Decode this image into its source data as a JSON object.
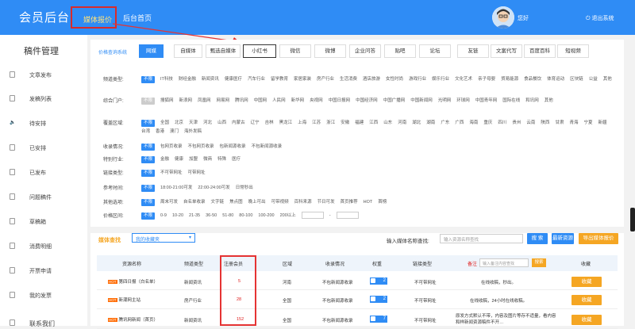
{
  "header": {
    "brand": "会员后台",
    "nav_active": "媒体报价",
    "nav_home": "后台首页",
    "greeting": "您好",
    "logout": "退出系统"
  },
  "sidebar": {
    "title": "稿件管理",
    "items": [
      {
        "label": "文章发布",
        "icon": "document-icon"
      },
      {
        "label": "发稿列表",
        "icon": "list-icon"
      },
      {
        "label": "待安排",
        "icon": "speaker-icon"
      },
      {
        "label": "已安排",
        "icon": "doc-check-icon"
      },
      {
        "label": "已发布",
        "icon": "doc-send-icon"
      },
      {
        "label": "问题稿件",
        "icon": "doc-warning-icon"
      },
      {
        "label": "草稿箱",
        "icon": "draft-icon"
      },
      {
        "label": "消费明细",
        "icon": "receipt-icon"
      },
      {
        "label": "开票申请",
        "icon": "invoice-icon"
      },
      {
        "label": "我的发票",
        "icon": "invoice-list-icon"
      },
      {
        "label": "联系我们",
        "icon": "contact-icon"
      }
    ]
  },
  "search_system": {
    "label": "价格查询系统",
    "tabs": [
      "网媒",
      "自媒体",
      "甄选自媒体",
      "小红书",
      "微信",
      "微博",
      "企业问答",
      "贴吧",
      "论坛",
      "友链",
      "文案代写",
      "百度百科",
      "短视频"
    ],
    "active_tab": "网媒"
  },
  "filters": [
    {
      "label": "频道类型:",
      "options": [
        "不限",
        "IT科技",
        "财经金融",
        "新闻资讯",
        "健康医疗",
        "汽车行业",
        "留学教育",
        "家居家装",
        "房产行业",
        "生活消费",
        "酒店旅游",
        "女性时尚",
        "游戏行业",
        "娱乐行业",
        "文化艺术",
        "亲子母婴",
        "贸易能源",
        "食品餐饮",
        "体育运动",
        "区块链",
        "公益",
        "其他"
      ]
    },
    {
      "label": "综合门户:",
      "options": [
        "不限",
        "搜狐网",
        "新浪网",
        "凤凰网",
        "网易网",
        "腾讯网",
        "中国网",
        "人民网",
        "新华网",
        "央视网",
        "中国日报网",
        "中国经济网",
        "中国广播网",
        "中国新闻网",
        "光明网",
        "环球网",
        "中国青年网",
        "国际在线",
        "和讯网",
        "其他"
      ]
    },
    {
      "label": "覆盖区域:",
      "options": [
        "不限",
        "全国",
        "北京",
        "天津",
        "河北",
        "山西",
        "内蒙古",
        "辽宁",
        "吉林",
        "黑龙江",
        "上海",
        "江苏",
        "浙江",
        "安徽",
        "福建",
        "江西",
        "山东",
        "河南",
        "湖北",
        "湖南",
        "广东",
        "广西",
        "海南",
        "重庆",
        "四川",
        "贵州",
        "云南",
        "陕西",
        "甘肃",
        "青海",
        "宁夏",
        "新疆",
        "台湾",
        "香港",
        "澳门",
        "海外发稿"
      ]
    },
    {
      "label": "收录情况:",
      "options": [
        "不限",
        "包网页收录",
        "不包网页收录",
        "包新闻源收录",
        "不包新闻源收录"
      ]
    },
    {
      "label": "特别行业:",
      "options": [
        "不限",
        "金融",
        "健康",
        "加盟",
        "微商",
        "特殊",
        "医疗"
      ]
    },
    {
      "label": "链接类型:",
      "options": [
        "不限",
        "不可带网址",
        "可带网址"
      ]
    },
    {
      "label": "参考时间:",
      "options": [
        "不限",
        "18:00-21:00可发",
        "22:00-24:00可发",
        "日常秒出"
      ]
    },
    {
      "label": "其他选项:",
      "options": [
        "不限",
        "周末可发",
        "自名单收录",
        "文字链",
        "焦点图",
        "晚上可出",
        "可带视频",
        "百科来源",
        "节日可发",
        "首页推荐",
        "HOT",
        "首榜"
      ]
    },
    {
      "label": "价格区间:",
      "options": [
        "不限",
        "0-9",
        "10-20",
        "21-35",
        "36-50",
        "51-80",
        "80-100",
        "100-200",
        "200以上"
      ]
    }
  ],
  "media_query": {
    "title": "媒体查找",
    "select_value": "我的收藏夹",
    "name_label": "输入媒体名称查找:",
    "name_placeholder": "输入资源名称查找",
    "search_btn": "搜 索",
    "new_btn": "最新资源",
    "export_btn": "导出媒体报价"
  },
  "table": {
    "headers": [
      "资源名称",
      "频道类型",
      "注册会员",
      "区域",
      "收录情况",
      "权重",
      "链接类型",
      "备注",
      "收藏"
    ],
    "note_placeholder": "输入备注内容查找",
    "note_search": "搜索",
    "rows": [
      {
        "name": "第四日报（白名单）",
        "channel": "新闻资讯",
        "price": "5",
        "region": "河南",
        "include": "不包新闻源收录",
        "weight": "2",
        "link": "不可带网址",
        "note": "在线收稿，秒出。",
        "action": "收藏"
      },
      {
        "name": "新潮网主站",
        "channel": "房产行业",
        "price": "28",
        "region": "全国",
        "include": "不包新闻源收录",
        "weight": "2",
        "link": "不可带网址",
        "note": "在线收稿，24小时在线收稿。",
        "action": "收藏"
      },
      {
        "name": "腾讯网新闻（首页）",
        "channel": "新闻资讯",
        "price": "152",
        "region": "全国",
        "include": "不包新闻源收录",
        "weight": "7",
        "link": "不可带网址",
        "note": "原发方式默认不带，内容及图片等存不适量，看内容和样新闻资源稿件不开…",
        "action": "收藏"
      }
    ]
  },
  "colors": {
    "primary": "#2f8cf5",
    "accent": "#f5a623",
    "highlight": "#e53333"
  }
}
